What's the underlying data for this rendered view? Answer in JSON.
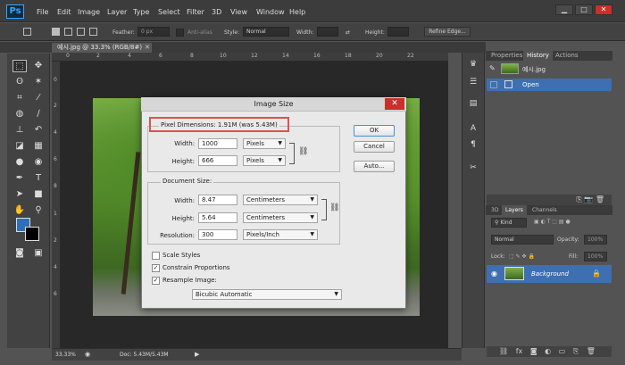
{
  "menubar": {
    "logo": "Ps",
    "items": [
      "File",
      "Edit",
      "Image",
      "Layer",
      "Type",
      "Select",
      "Filter",
      "3D",
      "View",
      "Window",
      "Help"
    ],
    "window_buttons": [
      "▁",
      "□",
      "✕"
    ]
  },
  "options": {
    "feather_label": "Feather:",
    "feather_value": "0 px",
    "antialias_label": "Anti-alias",
    "style_label": "Style:",
    "style_value": "Normal",
    "width_label": "Width:",
    "height_label": "Height:",
    "refine_edge": "Refine Edge..."
  },
  "document": {
    "tab_title": "예시.jpg @ 33.3% (RGB/8#)",
    "tab_close": "✕"
  },
  "ruler_top": [
    "0",
    "2",
    "4",
    "6",
    "8",
    "10",
    "12",
    "14",
    "16",
    "18",
    "20",
    "22"
  ],
  "ruler_left": [
    "0",
    "2",
    "4",
    "6",
    "8",
    "1",
    "2",
    "4",
    "6"
  ],
  "panels": {
    "tabs": [
      "Properties",
      "History",
      "Actions"
    ],
    "history_snapshot": "예시.jpg",
    "history_step": "Open",
    "layers_tabs": [
      "3D",
      "Layers",
      "Channels"
    ],
    "kind_label": "Kind",
    "blend_mode": "Normal",
    "opacity_label": "Opacity:",
    "opacity_value": "100%",
    "lock_label": "Lock:",
    "fill_label": "Fill:",
    "fill_value": "100%",
    "layer_name": "Background"
  },
  "status": {
    "zoom": "33.33%",
    "doc": "Doc: 5.43M/5.43M"
  },
  "dialog": {
    "title": "Image Size",
    "close": "✕",
    "pixel_dimensions": "Pixel Dimensions:  1.91M (was 5.43M)",
    "px_width_label": "Width:",
    "px_width_value": "1000",
    "px_width_unit": "Pixels",
    "px_height_label": "Height:",
    "px_height_value": "666",
    "px_height_unit": "Pixels",
    "document_size": "Document Size:",
    "doc_width_label": "Width:",
    "doc_width_value": "8.47",
    "doc_width_unit": "Centimeters",
    "doc_height_label": "Height:",
    "doc_height_value": "5.64",
    "doc_height_unit": "Centimeters",
    "resolution_label": "Resolution:",
    "resolution_value": "300",
    "resolution_unit": "Pixels/Inch",
    "scale_styles": "Scale Styles",
    "constrain_proportions": "Constrain Proportions",
    "resample_image": "Resample Image:",
    "resample_method": "Bicubic Automatic",
    "ok": "OK",
    "cancel": "Cancel",
    "auto": "Auto..."
  }
}
